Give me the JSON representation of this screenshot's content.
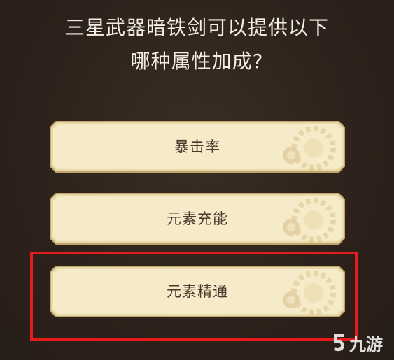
{
  "question": {
    "line1": "三星武器暗铁剑可以提供以下",
    "line2": "哪种属性加成?"
  },
  "options": [
    {
      "label": "暴击率",
      "highlighted": false
    },
    {
      "label": "元素充能",
      "highlighted": false
    },
    {
      "label": "元素精通",
      "highlighted": true
    }
  ],
  "highlight_color": "#e61b1b",
  "watermark": {
    "text": "九游",
    "icon": "jiuyou-logo-icon"
  },
  "colors": {
    "background": "#2f241d",
    "button_face": "#f3e8c4",
    "button_border": "#d4c08a",
    "text_light": "#f4efe6",
    "text_dark": "#4a3a2c"
  }
}
